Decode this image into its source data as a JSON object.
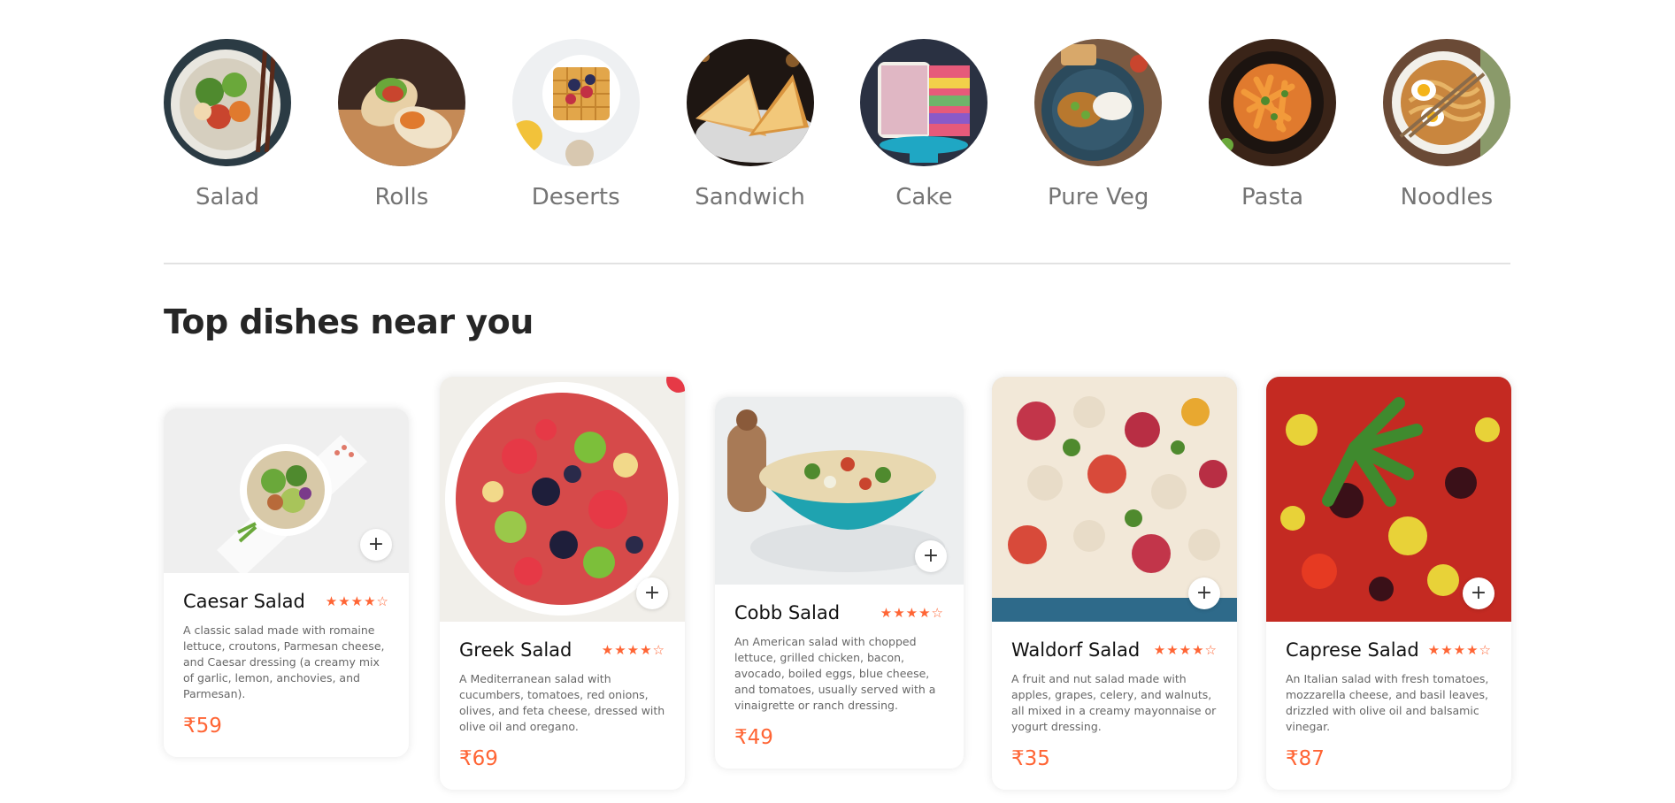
{
  "categories": [
    {
      "label": "Salad",
      "icon": "salad-photo"
    },
    {
      "label": "Rolls",
      "icon": "rolls-photo"
    },
    {
      "label": "Deserts",
      "icon": "waffle-photo"
    },
    {
      "label": "Sandwich",
      "icon": "sandwich-photo"
    },
    {
      "label": "Cake",
      "icon": "cake-photo"
    },
    {
      "label": "Pure Veg",
      "icon": "veg-plate-photo"
    },
    {
      "label": "Pasta",
      "icon": "pasta-photo"
    },
    {
      "label": "Noodles",
      "icon": "noodles-photo"
    }
  ],
  "section": {
    "title": "Top dishes near you"
  },
  "dishes": [
    {
      "name": "Caesar Salad",
      "rating": "★★★★☆",
      "add": "+",
      "description": "A classic salad made with romaine lettuce, croutons, Parmesan cheese, and Caesar dressing (a creamy mix of garlic, lemon, anchovies, and Parmesan).",
      "price": "₹59"
    },
    {
      "name": "Greek Salad",
      "rating": "★★★★☆",
      "add": "+",
      "description": "A Mediterranean salad with cucumbers, tomatoes, red onions, olives, and feta cheese, dressed with olive oil and oregano.",
      "price": "₹69"
    },
    {
      "name": "Cobb Salad",
      "rating": "★★★★☆",
      "add": "+",
      "description": "An American salad with chopped lettuce, grilled chicken, bacon, avocado, boiled eggs, blue cheese, and tomatoes, usually served with a vinaigrette or ranch dressing.",
      "price": "₹49"
    },
    {
      "name": "Waldorf Salad",
      "rating": "★★★★☆",
      "add": "+",
      "description": "A fruit and nut salad made with apples, grapes, celery, and walnuts, all mixed in a creamy mayonnaise or yogurt dressing.",
      "price": "₹35"
    },
    {
      "name": "Caprese Salad",
      "rating": "★★★★☆",
      "add": "+",
      "description": "An Italian salad with fresh tomatoes, mozzarella cheese, and basil leaves, drizzled with olive oil and balsamic vinegar.",
      "price": "₹87"
    }
  ],
  "colors": {
    "accent": "#ff6535",
    "muted_text": "#747474"
  }
}
